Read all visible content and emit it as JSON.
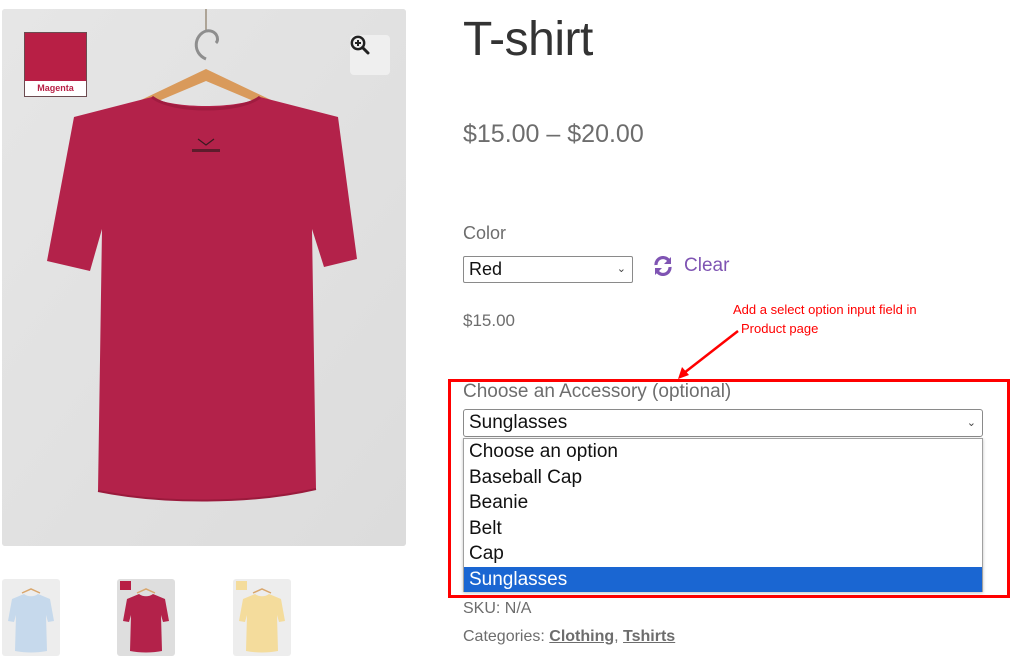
{
  "gallery": {
    "swatch_label": "Magenta",
    "swatch_color": "#b81f45",
    "zoom_icon": "zoom-in-icon",
    "thumbnails": [
      {
        "name": "light-blue-tshirt",
        "color": "#c6d9ec"
      },
      {
        "name": "red-tshirt",
        "color": "#b81f45",
        "active": true
      },
      {
        "name": "yellow-tshirt",
        "color": "#f4dc9c"
      }
    ]
  },
  "product": {
    "title": "T-shirt",
    "price_range": "$15.00 – $20.00",
    "color_label": "Color",
    "color_selected": "Red",
    "clear_label": "Clear",
    "clear_icon": "refresh-icon",
    "variation_price": "$15.00",
    "accessory_label": "Choose an Accessory (optional)",
    "accessory_selected": "Sunglasses",
    "accessory_options": [
      {
        "label": "Choose an option",
        "selected": false
      },
      {
        "label": "Baseball Cap",
        "selected": false
      },
      {
        "label": "Beanie",
        "selected": false
      },
      {
        "label": "Belt",
        "selected": false
      },
      {
        "label": "Cap",
        "selected": false
      },
      {
        "label": "Sunglasses",
        "selected": true
      }
    ],
    "sku_label": "SKU:",
    "sku_value": "N/A",
    "categories_label": "Categories:",
    "categories": [
      "Clothing",
      "Tshirts"
    ]
  },
  "annotation": {
    "line1": "Add a select option input field in",
    "line2": "Product page",
    "color": "#ff0000"
  },
  "colors": {
    "link": "#7f54b3",
    "highlight": "#1a66d2"
  }
}
